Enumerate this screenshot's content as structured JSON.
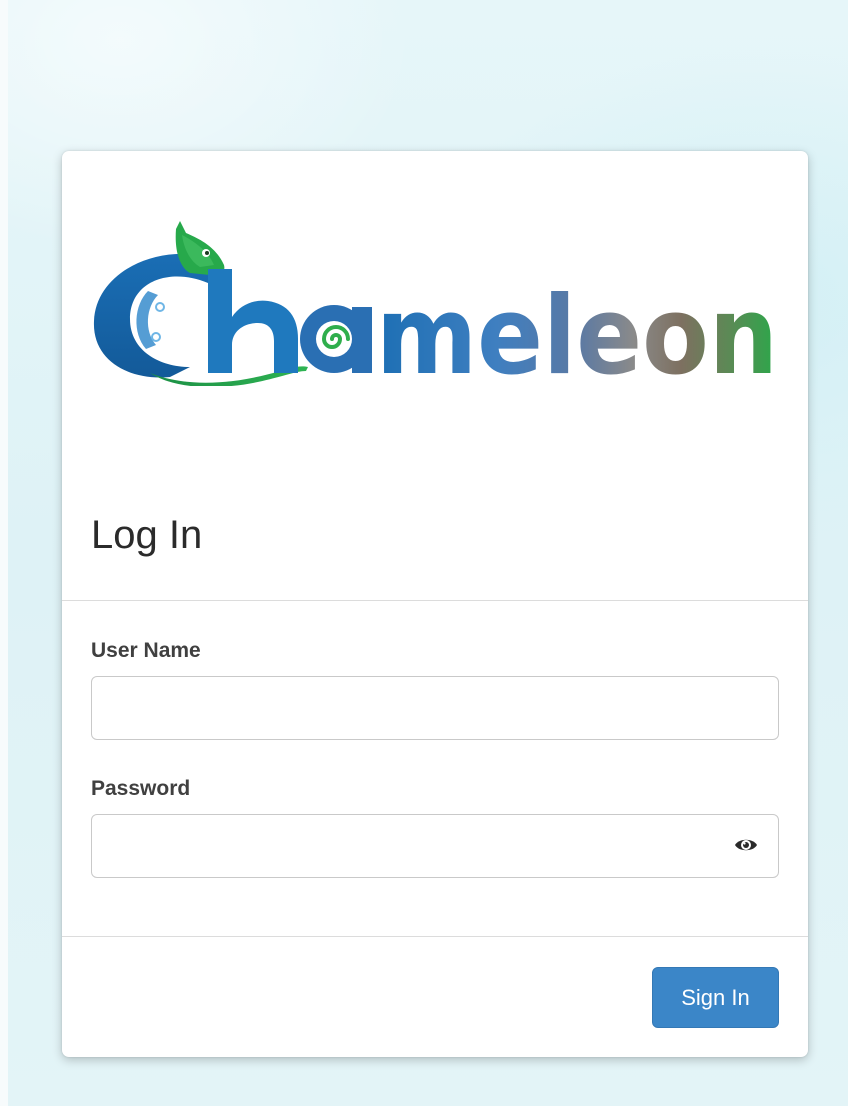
{
  "brand": {
    "logo_text": "Chameleon"
  },
  "login": {
    "title": "Log In",
    "username_label": "User Name",
    "username_value": "",
    "password_label": "Password",
    "password_value": "",
    "password_toggle_icon": "eye-icon",
    "submit_label": "Sign In"
  },
  "colors": {
    "primary_button": "#3b86c8",
    "background": "#e4f5f8",
    "logo_blue": "#1976bc",
    "logo_green": "#1fae4a",
    "logo_gray": "#7b7266"
  }
}
